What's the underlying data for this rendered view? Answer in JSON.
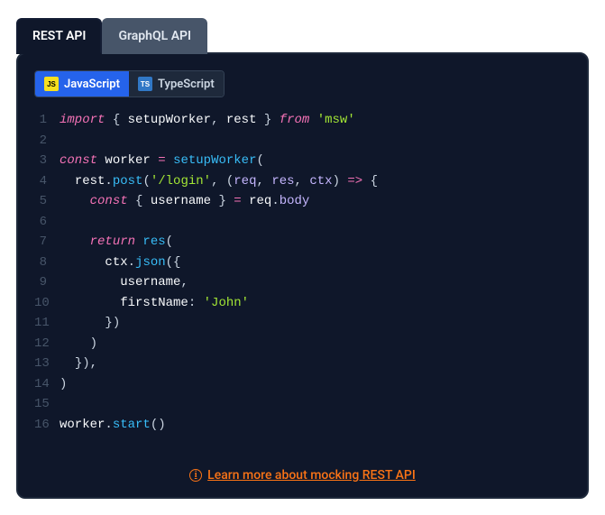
{
  "apiTabs": {
    "active": "REST API",
    "inactive": "GraphQL API"
  },
  "langTabs": {
    "active": "JavaScript",
    "activeBadge": "JS",
    "inactive": "TypeScript",
    "inactiveBadge": "TS"
  },
  "code": {
    "lines": {
      "n1": "1",
      "n2": "2",
      "n3": "3",
      "n4": "4",
      "n5": "5",
      "n6": "6",
      "n7": "7",
      "n8": "8",
      "n9": "9",
      "n10": "10",
      "n11": "11",
      "n12": "12",
      "n13": "13",
      "n14": "14",
      "n15": "15",
      "n16": "16"
    },
    "l1": {
      "import": "import",
      "ob": "{ ",
      "sw": "setupWorker",
      "c": ", ",
      "rest": "rest",
      "cb": " }",
      "from": " from ",
      "msw": "'msw'"
    },
    "l3": {
      "const": "const ",
      "worker": "worker",
      "eq": " = ",
      "sw": "setupWorker",
      "op": "("
    },
    "l4": {
      "ind": "  ",
      "rest": "rest",
      "dot": ".",
      "post": "post",
      "op": "(",
      "route": "'/login'",
      "c": ", ",
      "po": "(",
      "req": "req",
      "c2": ", ",
      "res": "res",
      "c3": ", ",
      "ctx": "ctx",
      "pc": ")",
      "arrow": " => ",
      "ob": "{"
    },
    "l5": {
      "ind": "    ",
      "const": "const ",
      "ob": "{ ",
      "un": "username",
      "cb": " }",
      "eq": " = ",
      "req": "req",
      "dot": ".",
      "body": "body"
    },
    "l7": {
      "ind": "    ",
      "ret": "return ",
      "res": "res",
      "op": "("
    },
    "l8": {
      "ind": "      ",
      "ctx": "ctx",
      "dot": ".",
      "json": "json",
      "op": "({"
    },
    "l9": {
      "ind": "        ",
      "un": "username",
      "c": ","
    },
    "l10": {
      "ind": "        ",
      "fn": "firstName",
      "col": ": ",
      "john": "'John'"
    },
    "l11": {
      "ind": "      ",
      "cl": "})"
    },
    "l12": {
      "ind": "    ",
      "cl": ")"
    },
    "l13": {
      "ind": "  ",
      "cl": "}),"
    },
    "l14": {
      "cl": ")"
    },
    "l16": {
      "worker": "worker",
      "dot": ".",
      "start": "start",
      "par": "()"
    }
  },
  "learn": {
    "icon": "i",
    "text": "Learn more about mocking REST API"
  }
}
